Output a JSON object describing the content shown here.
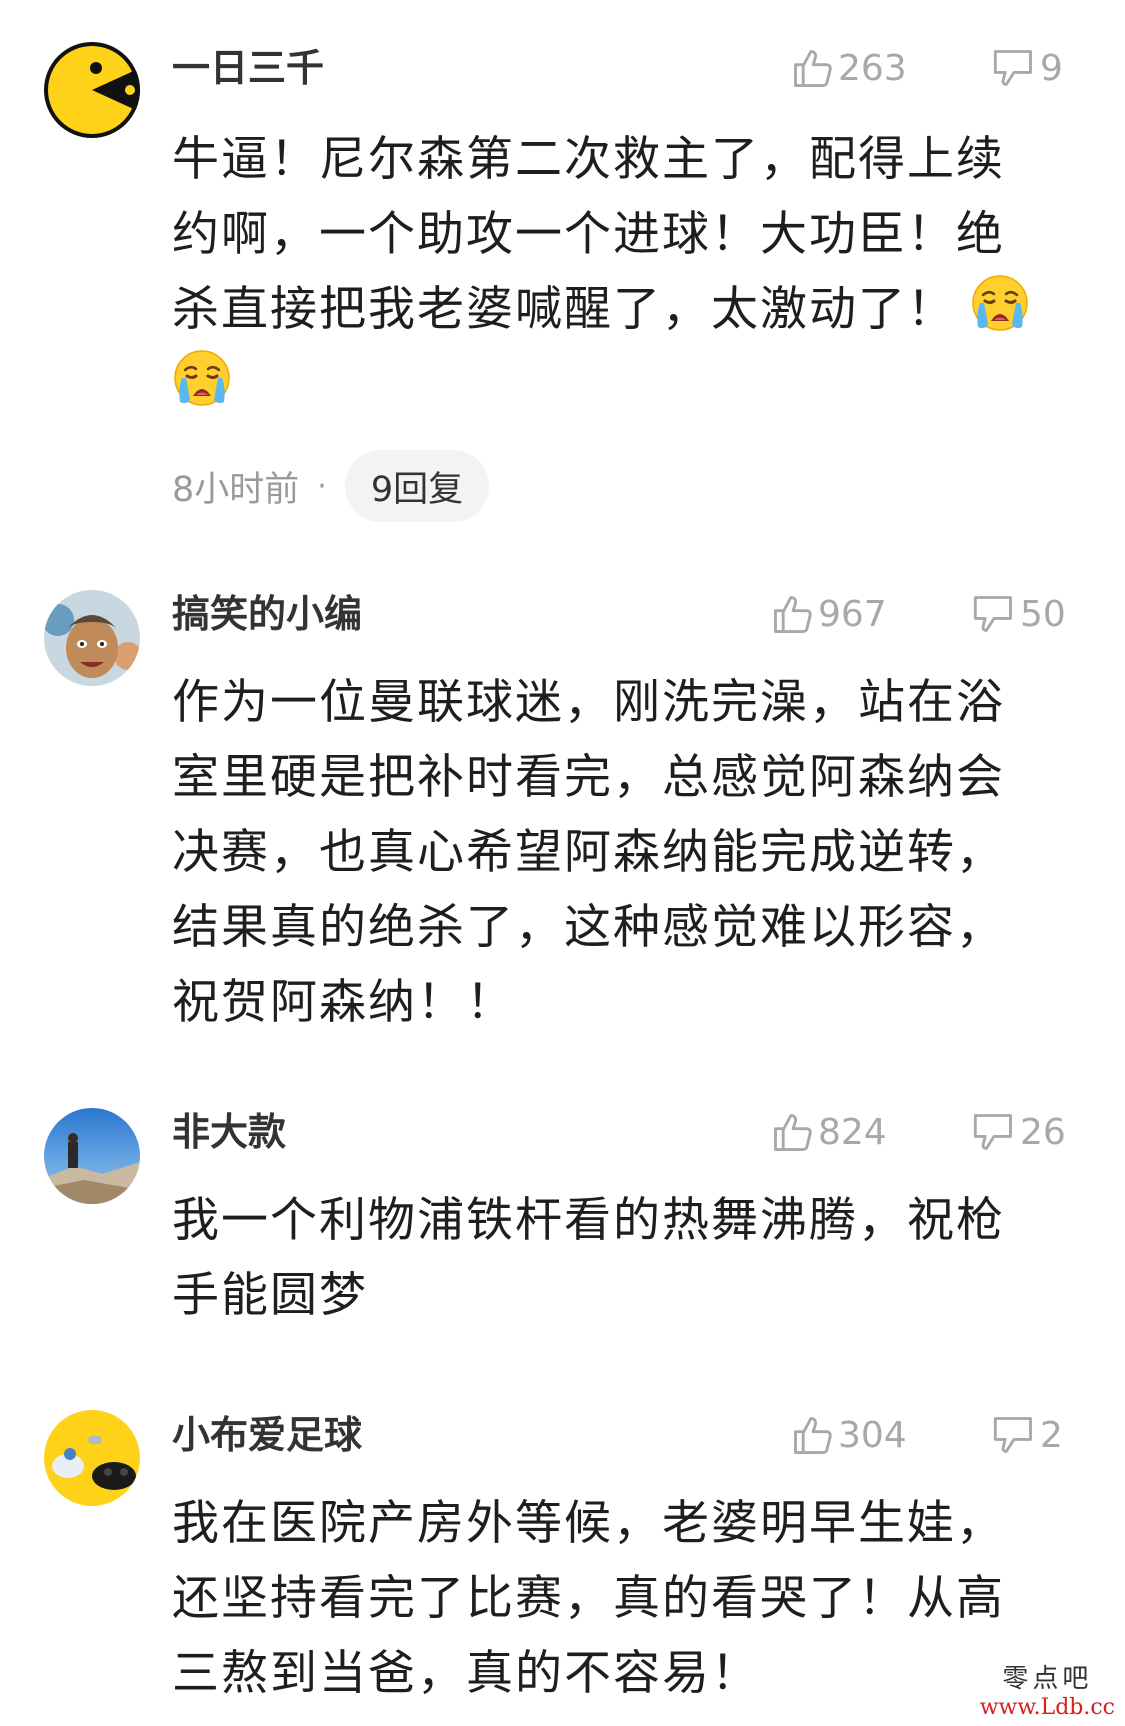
{
  "comments": [
    {
      "username": "一日三千",
      "avatar_icon": "pacman-avatar-icon",
      "likes": "263",
      "dislikes": "9",
      "lines": [
        "牛逼！尼尔森第二次救主了，配得上续",
        "约啊，一个助攻一个进球！大功臣！绝",
        "杀直接把我老婆喊醒了，太激动了！"
      ],
      "emoji": "crying-face-emoji",
      "time": "8小时前",
      "dot": "·",
      "replies": "9回复"
    },
    {
      "username": "搞笑的小编",
      "avatar_icon": "cartoon-face-avatar-icon",
      "likes": "967",
      "dislikes": "50",
      "lines": [
        "作为一位曼联球迷，刚洗完澡，站在浴",
        "室里硬是把补时看完，总感觉阿森纳会",
        "决赛，也真心希望阿森纳能完成逆转，",
        "结果真的绝杀了，这种感觉难以形容，",
        "祝贺阿森纳！！"
      ]
    },
    {
      "username": "非大款",
      "avatar_icon": "mountain-photo-avatar-icon",
      "likes": "824",
      "dislikes": "26",
      "lines": [
        "我一个利物浦铁杆看的热舞沸腾，祝枪",
        "手能圆梦"
      ]
    },
    {
      "username": "小布爱足球",
      "avatar_icon": "toys-avatar-icon",
      "likes": "304",
      "dislikes": "2",
      "lines": [
        "我在医院产房外等候，老婆明早生娃，",
        "还坚持看完了比赛，真的看哭了！从高",
        "三熬到当爸，真的不容易！"
      ]
    }
  ],
  "watermark": {
    "title": "零点吧",
    "url": "www.Ldb.cc"
  },
  "colors": {
    "stat_gray": "#a8a8a8",
    "text": "#1e1e1e",
    "pill_bg": "#f3f3f3"
  }
}
